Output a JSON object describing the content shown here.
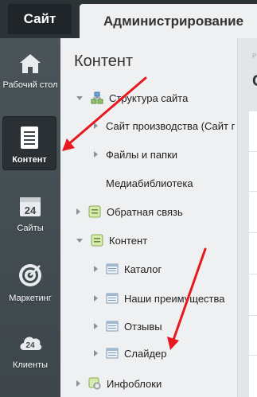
{
  "tabs": {
    "site": "Сайт",
    "admin": "Администрирование"
  },
  "left_menu": [
    {
      "label": "Рабочий стол",
      "icon": "home-icon"
    },
    {
      "label": "Контент",
      "icon": "document-icon",
      "active": true
    },
    {
      "label": "Сайты",
      "icon": "calendar-icon",
      "badge": "24"
    },
    {
      "label": "Маркетинг",
      "icon": "target-icon"
    },
    {
      "label": "Клиенты",
      "icon": "cloud-icon",
      "badge": "24"
    }
  ],
  "panel": {
    "title": "Контент",
    "tree": [
      {
        "label": "Структура сайта",
        "expanded": true
      },
      {
        "label": "Сайт производства (Сайт г"
      },
      {
        "label": "Файлы и папки"
      },
      {
        "label": "Медиабиблиотека"
      },
      {
        "label": "Обратная связь"
      },
      {
        "label": "Контент",
        "expanded": true
      },
      {
        "label": "Каталог"
      },
      {
        "label": "Наши преимущества"
      },
      {
        "label": "Отзывы"
      },
      {
        "label": "Слайдер"
      },
      {
        "label": "Инфоблоки"
      }
    ]
  },
  "right_strip": {
    "small_text": "Р",
    "big_text": "С"
  },
  "colors": {
    "annotation_arrow": "#e8191e",
    "sidebar_bg": "#434c51",
    "topbar_bg": "#2c3337"
  }
}
